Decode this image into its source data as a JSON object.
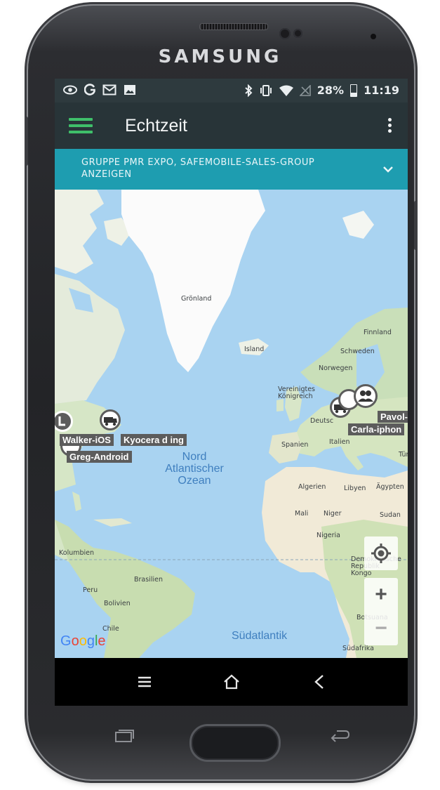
{
  "device": {
    "brand": "SAMSUNG"
  },
  "status_bar": {
    "left_icons": [
      "eye-icon",
      "google-icon",
      "mail-icon",
      "image-icon"
    ],
    "right_icons": [
      "bluetooth-icon",
      "vibrate-icon",
      "wifi-icon",
      "no-signal-icon"
    ],
    "battery": "28%",
    "time": "11:19"
  },
  "toolbar": {
    "menu_icon": "hamburger-icon",
    "title": "Echtzeit",
    "overflow_icon": "more-vert-icon",
    "accent": "#3fbf6a"
  },
  "group_bar": {
    "text": "Gruppe PMR Expo, SafeMobile-sales-group anzeigen",
    "expand_icon": "chevron-down-icon",
    "color": "#1e9db0"
  },
  "map": {
    "labels": {
      "greenland": "Grönland",
      "iceland": "Island",
      "finland": "Finnland",
      "sweden": "Schweden",
      "norway": "Norwegen",
      "uk": "Vereinigtes Königreich",
      "germany": "Deutsc",
      "spain": "Spanien",
      "italy": "Italien",
      "turkey": "Tür",
      "algeria": "Algerien",
      "libya": "Libyen",
      "egypt": "Ägypten",
      "mali": "Mali",
      "niger": "Niger",
      "sudan": "Sudan",
      "nigeria": "Nigeria",
      "colombia": "Kolumbien",
      "brazil": "Brasilien",
      "peru": "Peru",
      "bolivia": "Bolivien",
      "chile": "Chile",
      "botswana": "Botsuana",
      "south_africa": "Südafrika",
      "congo": "Demokratische Republik Kongo",
      "north_atlantic": "Nord Atlantischer Ozean",
      "south_atlantic": "Südatlantik"
    },
    "markers": [
      {
        "name": "Walker-iOS",
        "icon": "location-pin-icon"
      },
      {
        "name": "Kyocera d ing",
        "icon": "vehicle-icon"
      },
      {
        "name": "Greg-Android",
        "icon": "location-pin-icon"
      },
      {
        "name": "Pavol-I",
        "icon": "group-icon"
      },
      {
        "name": "Carla-iphon",
        "icon": "vehicle-icon"
      }
    ],
    "controls": {
      "locate": "my-location-icon",
      "zoom_in": "+",
      "zoom_out": "−"
    },
    "attribution": "Google"
  },
  "nav_bar": {
    "menu": "≡",
    "home": "home-icon",
    "back": "<"
  }
}
